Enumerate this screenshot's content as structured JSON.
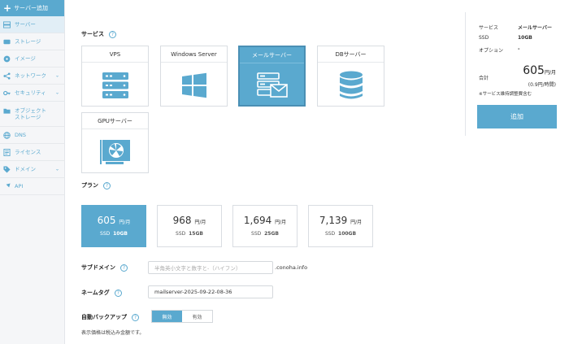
{
  "colors": {
    "accent": "#5aa9cf",
    "sidebar_bg": "#f5f6f8",
    "border": "#d9dde2"
  },
  "sidebar": {
    "add_label": "サーバー追加",
    "items": [
      {
        "label": "サーバー",
        "icon": "server-icon"
      },
      {
        "label": "ストレージ",
        "icon": "storage-icon"
      },
      {
        "label": "イメージ",
        "icon": "image-icon"
      },
      {
        "label": "ネットワーク",
        "icon": "network-icon"
      },
      {
        "label": "セキュリティ",
        "icon": "key-icon"
      },
      {
        "label": "オブジェクト",
        "label2": "ストレージ",
        "icon": "folder-icon"
      },
      {
        "label": "DNS",
        "icon": "globe-icon"
      },
      {
        "label": "ライセンス",
        "icon": "license-icon"
      },
      {
        "label": "ドメイン",
        "icon": "tag-icon"
      },
      {
        "label": "API",
        "icon": "api-icon"
      }
    ]
  },
  "service": {
    "label": "サービス",
    "help": "?",
    "cards": [
      {
        "title": "VPS",
        "icon": "vps-server-icon"
      },
      {
        "title": "Windows Server",
        "icon": "windows-icon"
      },
      {
        "title": "メールサーバー",
        "icon": "mail-server-icon"
      },
      {
        "title": "DBサーバー",
        "icon": "database-icon"
      },
      {
        "title": "GPUサーバー",
        "icon": "gpu-icon"
      }
    ]
  },
  "plan": {
    "label": "プラン",
    "help": "?",
    "plans": [
      {
        "price": "605",
        "unit": "円/月",
        "ssd_label": "SSD",
        "ssd": "10GB"
      },
      {
        "price": "968",
        "unit": "円/月",
        "ssd_label": "SSD",
        "ssd": "15GB"
      },
      {
        "price": "1,694",
        "unit": "円/月",
        "ssd_label": "SSD",
        "ssd": "25GB"
      },
      {
        "price": "7,139",
        "unit": "円/月",
        "ssd_label": "SSD",
        "ssd": "100GB"
      }
    ]
  },
  "subdomain": {
    "label": "サブドメイン",
    "help": "?",
    "placeholder": "半角英小文字と数字と-（ハイフン）",
    "suffix": ".conoha.info"
  },
  "nametag": {
    "label": "ネームタグ",
    "help": "?",
    "value": "mailserver-2025-09-22-08-36"
  },
  "backup": {
    "label": "自動バックアップ",
    "help": "?",
    "off": "無効",
    "on": "有効"
  },
  "note": "表示価格は税込み金額です。",
  "summary": {
    "rows": [
      {
        "key": "サービス",
        "value": "メールサーバー"
      },
      {
        "key": "SSD",
        "value": "10GB"
      },
      {
        "key": "オプション",
        "value": "-"
      }
    ],
    "total_label": "合計",
    "total": "605",
    "total_unit": "円/月",
    "hourly": "(0.9円/時間)",
    "tax_note": "※サービス維持調整費含む",
    "add_button": "追加"
  }
}
